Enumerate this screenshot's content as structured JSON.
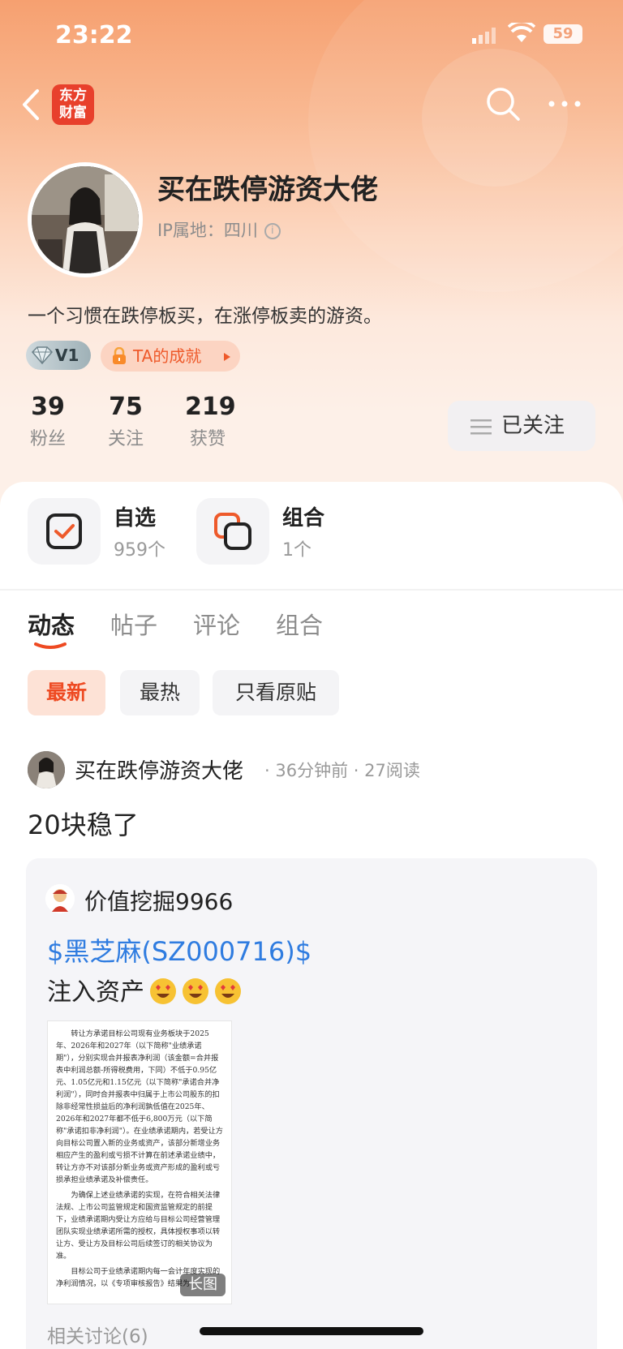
{
  "status_bar": {
    "time": "23:22",
    "battery": "59"
  },
  "header": {
    "app_logo_text": "东方\n财富"
  },
  "profile": {
    "username": "买在跌停游资大佬",
    "ip_location": "IP属地：四川",
    "bio": "一个习惯在跌停板买，在涨停板卖的游资。",
    "level_badge": "V1",
    "achievement_badge": "TA的成就",
    "stats": [
      {
        "value": "39",
        "label": "粉丝"
      },
      {
        "value": "75",
        "label": "关注"
      },
      {
        "value": "219",
        "label": "获赞"
      }
    ],
    "follow_button": "已关注"
  },
  "shortcuts": [
    {
      "title": "自选",
      "count": "959个"
    },
    {
      "title": "组合",
      "count": "1个"
    }
  ],
  "tabs": [
    {
      "label": "动态",
      "active": true
    },
    {
      "label": "帖子",
      "active": false
    },
    {
      "label": "评论",
      "active": false
    },
    {
      "label": "组合",
      "active": false
    }
  ],
  "filters": [
    {
      "label": "最新",
      "active": true
    },
    {
      "label": "最热",
      "active": false
    },
    {
      "label": "只看原贴",
      "active": false
    }
  ],
  "post": {
    "author": "买在跌停游资大佬",
    "meta": "·  36分钟前  ·  27阅读",
    "text": "20块稳了",
    "quoted": {
      "author": "价值挖掘9966",
      "stock": "$黑芝麻(SZ000716)$",
      "line": "注入资产",
      "image_tag": "长图",
      "doc_paragraphs": [
        "转让方承诺目标公司现有业务板块于2025年、2026年和2027年（以下简称\"业绩承诺期\"），分别实现合并报表净利润（该金额=合并报表中利润总额-所得税费用，下同）不低于0.95亿元、1.05亿元和1.15亿元（以下简称\"承诺合并净利润\"），同时合并报表中归属于上市公司股东的扣除非经常性损益后的净利润孰低值在2025年、2026年和2027年都不低于6,800万元（以下简称\"承诺扣非净利润\"）。在业绩承诺期内，若受让方向目标公司置入新的业务或资产，该部分新增业务相应产生的盈利或亏损不计算在前述承诺业绩中，转让方亦不对该部分新业务或资产形成的盈利或亏损承担业绩承诺及补偿责任。",
        "为确保上述业绩承诺的实现，在符合相关法律法规、上市公司监管规定和国资监管规定的前提下，业绩承诺期内受让方应给与目标公司经营管理团队实现业绩承诺所需的授权，具体授权事项以转让方、受让方及目标公司后续签订的相关协议为准。",
        "目标公司于业绩承诺期内每一会计年度实现的净利润情况，以《专项审核报告》结果为"
      ]
    },
    "related": "相关讨论(6)"
  },
  "colors": {
    "accent": "#ee4a22",
    "link": "#2f7ce0",
    "hero_top": "#f6a070"
  }
}
